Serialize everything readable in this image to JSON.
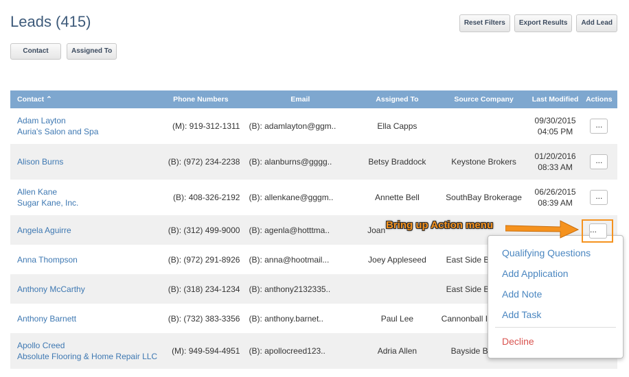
{
  "page": {
    "title": "Leads (415)"
  },
  "toolbar": {
    "reset_filters": "Reset Filters",
    "export_results": "Export Results",
    "add_lead": "Add Lead"
  },
  "filters": {
    "contact": "Contact",
    "assigned_to": "Assigned To"
  },
  "table": {
    "columns": {
      "contact": "Contact ⌃",
      "phone": "Phone Numbers",
      "email": "Email",
      "assigned": "Assigned To",
      "source": "Source Company",
      "modified": "Last Modified",
      "actions": "Actions"
    },
    "rows": [
      {
        "name": "Adam Layton",
        "company": "Auria's Salon and Spa",
        "phone": "(M): 919-312-1311",
        "email": "(B): adamlayton@ggm..",
        "assigned": "Ella Capps",
        "source": "",
        "date": "09/30/2015",
        "time": "04:05 PM"
      },
      {
        "name": "Alison Burns",
        "company": "",
        "phone": "(B): (972) 234-2238",
        "email": "(B): alanburns@gggg..",
        "assigned": "Betsy Braddock",
        "source": "Keystone Brokers",
        "date": "01/20/2016",
        "time": "08:33 AM"
      },
      {
        "name": "Allen Kane",
        "company": "Sugar Kane, Inc.",
        "phone": "(B): 408-326-2192",
        "email": "(B): allenkane@gggm..",
        "assigned": "Annette Bell",
        "source": "SouthBay Brokerage",
        "date": "06/26/2015",
        "time": "08:39 AM"
      },
      {
        "name": "Angela Aguirre",
        "company": "",
        "phone": "(B): (312) 499-9000",
        "email": "(B): agenla@hotttma..",
        "assigned": "Joan",
        "source": "",
        "date": "",
        "time": ""
      },
      {
        "name": "Anna Thompson",
        "company": "",
        "phone": "(B): (972) 291-8926",
        "email": "(B): anna@hootmail...",
        "assigned": "Joey Appleseed",
        "source": "East Side B",
        "date": "",
        "time": ""
      },
      {
        "name": "Anthony McCarthy",
        "company": "",
        "phone": "(B): (318) 234-1234",
        "email": "(B): anthony2132335..",
        "assigned": "",
        "source": "East Side B",
        "date": "",
        "time": ""
      },
      {
        "name": "Anthony Barnett",
        "company": "",
        "phone": "(B): (732) 383-3356",
        "email": "(B): anthony.barnet..",
        "assigned": "Paul Lee",
        "source": "Cannonball I",
        "date": "",
        "time": ""
      },
      {
        "name": "Apollo Creed",
        "company": "Absolute Flooring & Home Repair LLC",
        "phone": "(M): 949-594-4951",
        "email": "(B): apollocreed123..",
        "assigned": "Adria Allen",
        "source": "Bayside B",
        "date": "",
        "time": ""
      }
    ],
    "actions_label": "..."
  },
  "action_menu": {
    "items": [
      "Qualifying Questions",
      "Add Application",
      "Add Note",
      "Add Task"
    ],
    "danger": "Decline"
  },
  "annotation": {
    "callout": "Bring up Action menu",
    "color": "#f5921e"
  }
}
